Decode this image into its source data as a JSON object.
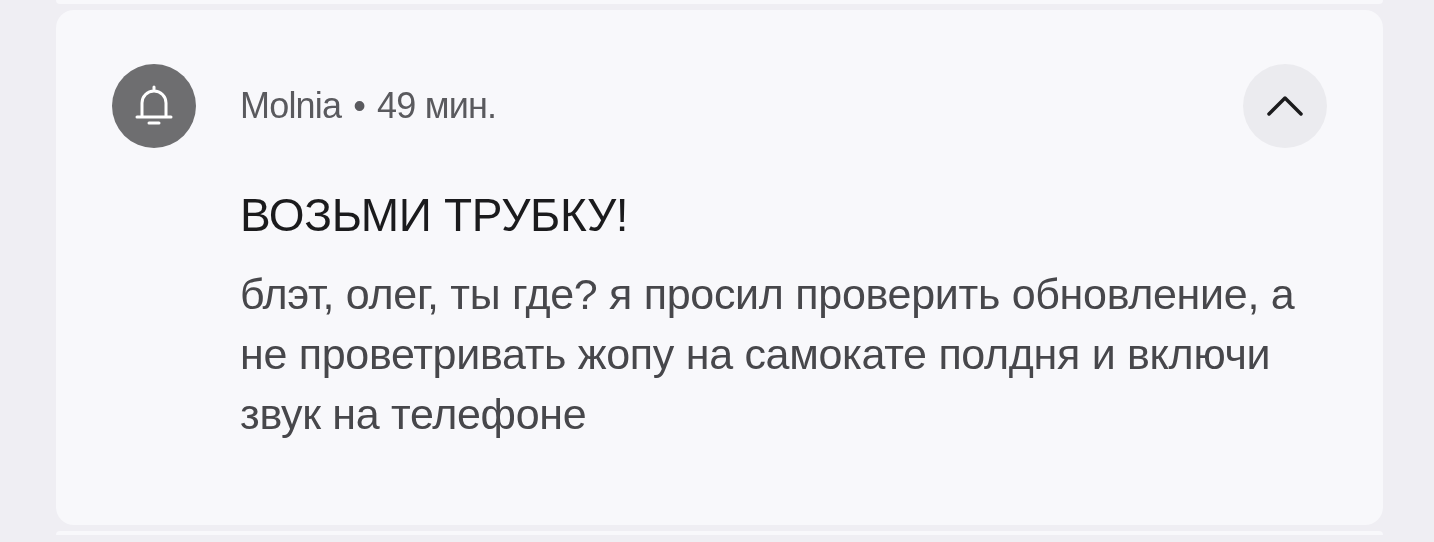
{
  "notification": {
    "app": "Molnia",
    "separator": "•",
    "time": "49 мин.",
    "expanded": true,
    "title": "ВОЗЬМИ ТРУБКУ!",
    "body": "блэт, олег, ты где? я просил проверить обновление, а не проветривать жопу на самокате полдня и включи звук на телефоне"
  }
}
